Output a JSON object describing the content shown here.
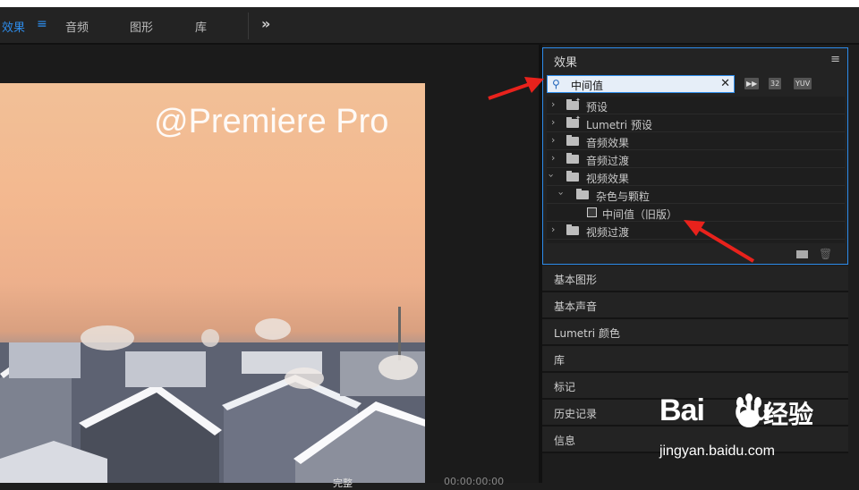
{
  "workspaces": [
    {
      "label": "效果",
      "active": true
    },
    {
      "label": "音频",
      "active": false
    },
    {
      "label": "图形",
      "active": false
    },
    {
      "label": "库",
      "active": false
    }
  ],
  "topbar": {
    "menu_icon": "hamburger-icon",
    "more_icon": "double-chevron-right-icon",
    "more_glyph": "»"
  },
  "monitor": {
    "watermark": "@Premiere Pro",
    "fit_label": "完整",
    "timecode": "00:00:00:00"
  },
  "effects_panel": {
    "title": "效果",
    "menu_glyph": "≡",
    "search": {
      "value": "中间值",
      "clear_glyph": "✕",
      "icon": "search-icon"
    },
    "badges": [
      "▶▶",
      "32",
      "YUV"
    ],
    "tree": [
      {
        "label": "预设",
        "expanded": false,
        "icon": "preset-folder-icon",
        "level": 0
      },
      {
        "label": "Lumetri 预设",
        "expanded": false,
        "icon": "preset-folder-icon",
        "level": 0
      },
      {
        "label": "音频效果",
        "expanded": false,
        "icon": "folder-icon",
        "level": 0
      },
      {
        "label": "音频过渡",
        "expanded": false,
        "icon": "folder-icon",
        "level": 0
      },
      {
        "label": "视频效果",
        "expanded": true,
        "icon": "folder-icon",
        "level": 0
      },
      {
        "label": "杂色与颗粒",
        "expanded": true,
        "icon": "folder-icon",
        "level": 1
      },
      {
        "label": "中间值（旧版）",
        "expanded": null,
        "icon": "effect-icon",
        "level": 2
      },
      {
        "label": "视频过渡",
        "expanded": false,
        "icon": "folder-icon",
        "level": 0
      }
    ]
  },
  "panels": [
    "基本图形",
    "基本声音",
    "Lumetri 颜色",
    "库",
    "标记",
    "历史记录",
    "信息"
  ],
  "watermark_site": {
    "logo": "Bai",
    "logo_suffix": "du",
    "cn": "经验",
    "url": "jingyan.baidu.com"
  },
  "colors": {
    "accent": "#2d8ceb",
    "annotation_arrow": "#e8221c",
    "panel_bg": "#232323"
  }
}
